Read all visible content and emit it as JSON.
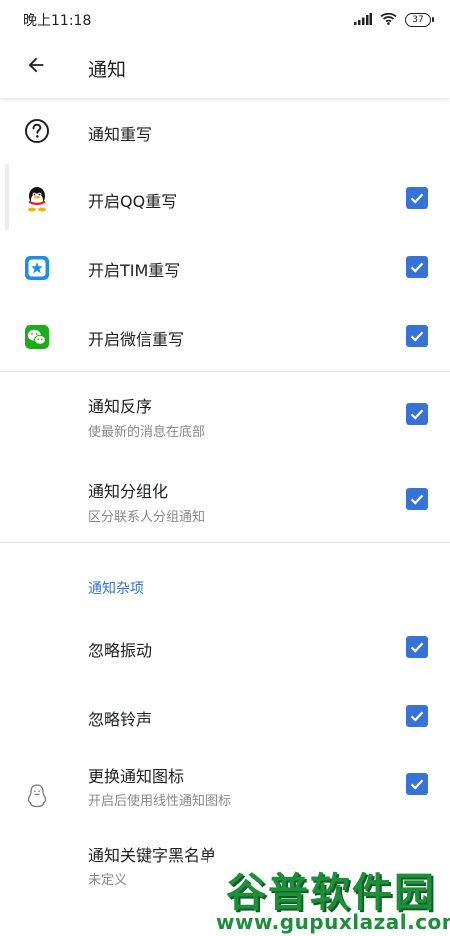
{
  "status_bar": {
    "time": "晚上11:18",
    "battery": "37",
    "icons": [
      "signal-icon",
      "wifi-icon",
      "battery-icon"
    ]
  },
  "app_bar": {
    "title": "通知",
    "back_icon": "arrow-left-icon"
  },
  "rows": {
    "notify_rewrite": {
      "title": "通知重写",
      "icon": "help-circle-icon"
    },
    "qq_rewrite": {
      "title": "开启QQ重写",
      "icon": "qq-penguin-icon",
      "checked": true
    },
    "tim_rewrite": {
      "title": "开启TIM重写",
      "icon": "tim-app-icon",
      "checked": true
    },
    "wechat_rewrite": {
      "title": "开启微信重写",
      "icon": "wechat-icon",
      "checked": true
    },
    "reverse_order": {
      "title": "通知反序",
      "subtitle": "使最新的消息在底部",
      "checked": true
    },
    "grouping": {
      "title": "通知分组化",
      "subtitle": "区分联系人分组通知",
      "checked": true
    }
  },
  "section": {
    "title": "通知杂项",
    "accent_color": "#3772d6"
  },
  "misc_rows": {
    "ignore_vibration": {
      "title": "忽略振动",
      "checked": true
    },
    "ignore_ringtone": {
      "title": "忽略铃声",
      "checked": true
    },
    "change_icon": {
      "title": "更换通知图标",
      "subtitle": "开启后使用线性通知图标",
      "icon": "penguin-outline-icon",
      "checked": true
    },
    "keyword_blacklist": {
      "title": "通知关键字黑名单",
      "subtitle": "未定义"
    }
  },
  "watermark": {
    "text": "谷普软件园",
    "url": "www.gupuxlazal.com"
  }
}
